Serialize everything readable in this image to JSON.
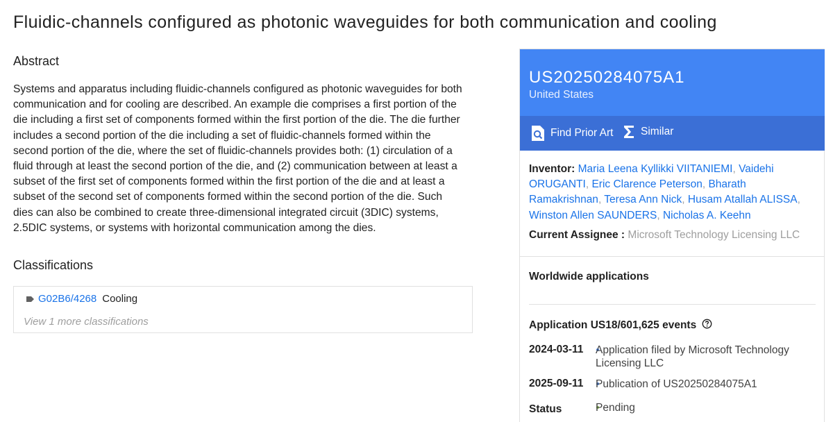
{
  "title": "Fluidic-channels configured as photonic waveguides for both communication and cooling",
  "abstract": {
    "heading": "Abstract",
    "text": "Systems and apparatus including fluidic-channels configured as photonic waveguides for both communication and for cooling are described. An example die comprises a first portion of the die including a first set of components formed within the first portion of the die. The die further includes a second portion of the die including a set of fluidic-channels formed within the second portion of the die, where the set of fluidic-channels provides both: (1) circulation of a fluid through at least the second portion of the die, and (2) communication between at least a subset of the first set of components formed within the first portion of the die and at least a subset of the second set of components formed within the second portion of the die. Such dies can also be combined to create three-dimensional integrated circuit (3DIC) systems, 2.5DIC systems, or systems with horizontal communication among the dies."
  },
  "classifications": {
    "heading": "Classifications",
    "code": "G02B6/4268",
    "description": "Cooling",
    "view_more": "View 1 more classifications"
  },
  "panel": {
    "publication_number": "US20250284075A1",
    "country": "United States",
    "find_prior_art": "Find Prior Art",
    "similar": "Similar",
    "inventor_label": "Inventor:",
    "inventors": [
      "Maria Leena Kyllikki VIITANIEMI",
      "Vaidehi ORUGANTI",
      "Eric Clarence Peterson",
      "Bharath Ramakrishnan",
      "Teresa Ann Nick",
      "Husam Atallah ALISSA",
      "Winston Allen SAUNDERS",
      "Nicholas A. Keehn"
    ],
    "separator": ",",
    "assignee_label": "Current Assignee :",
    "assignee": "Microsoft Technology Licensing LLC",
    "worldwide": "Worldwide applications",
    "events_heading": "Application US18/601,625 events",
    "events": [
      {
        "date": "2024-03-11",
        "text": "Application filed by Microsoft Technology Licensing LLC",
        "dot_color": "#4285f4"
      },
      {
        "date": "2025-09-11",
        "text": "Publication of US20250284075A1",
        "dot_color": "#4285f4"
      },
      {
        "date": "Status",
        "text": "Pending",
        "dot_color": "#8bc34a"
      }
    ]
  },
  "colors": {
    "accent": "#4285f4",
    "link": "#1a73e8",
    "bar": "#3b6fd6"
  }
}
